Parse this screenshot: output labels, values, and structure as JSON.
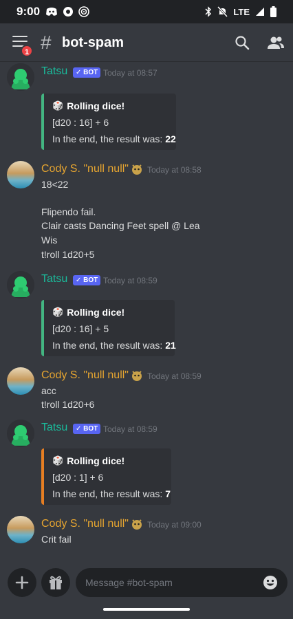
{
  "status_bar": {
    "time": "9:00",
    "network": "LTE"
  },
  "header": {
    "channel": "bot-spam",
    "notification_count": "1"
  },
  "messages": [
    {
      "author": "Tatsu",
      "bot_tag": "✓ BOT",
      "timestamp": "Today at 08:57",
      "embed": {
        "title": "Rolling dice!",
        "formula": "[d20 : 16] + 6",
        "result_prefix": "In the end, the result was: ",
        "result": "22",
        "accent": "#43b581"
      }
    },
    {
      "author": "Cody S. \"null null\"",
      "timestamp": "Today at 08:58",
      "lines": [
        "18<22",
        "Flipendo fail.",
        "Clair casts Dancing Feet spell @ Lea",
        "Wis",
        "t!roll 1d20+5"
      ]
    },
    {
      "author": "Tatsu",
      "bot_tag": "✓ BOT",
      "timestamp": "Today at 08:59",
      "embed": {
        "title": "Rolling dice!",
        "formula": "[d20 : 16] + 5",
        "result_prefix": "In the end, the result was: ",
        "result": "21",
        "accent": "#43b581"
      }
    },
    {
      "author": "Cody S. \"null null\"",
      "timestamp": "Today at 08:59",
      "lines": [
        "acc",
        "t!roll 1d20+6"
      ]
    },
    {
      "author": "Tatsu",
      "bot_tag": "✓ BOT",
      "timestamp": "Today at 08:59",
      "embed": {
        "title": "Rolling dice!",
        "formula": "[d20 : 1] + 6",
        "result_prefix": "In the end, the result was: ",
        "result": "7",
        "accent": "#e67e22"
      }
    },
    {
      "author": "Cody S. \"null null\"",
      "timestamp": "Today at 09:00",
      "lines": [
        "Crit fail"
      ]
    }
  ],
  "composer": {
    "placeholder": "Message #bot-spam"
  },
  "colors": {
    "background": "#36393f",
    "bot_name": "#1abc9c",
    "user_name": "#e6a530",
    "bot_tag": "#5865f2"
  },
  "icons": [
    "menu-icon",
    "hash-icon",
    "search-icon",
    "members-icon",
    "dice-icon",
    "plus-icon",
    "gift-icon",
    "emoji-icon"
  ]
}
